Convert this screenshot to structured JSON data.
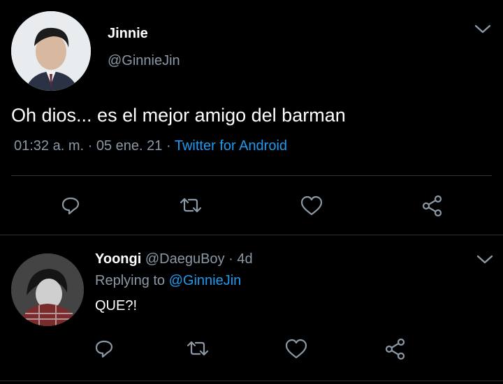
{
  "main_tweet": {
    "display_name": "Jinnie",
    "handle": "@GinnieJin",
    "text": "Oh dios... es el mejor amigo del barman",
    "time": "01:32 a. m.",
    "sep1": "·",
    "date": "05 ene. 21",
    "sep2": "·",
    "source": "Twitter for Android",
    "actions": [
      "reply-icon",
      "retweet-icon",
      "like-icon",
      "share-icon"
    ]
  },
  "reply_tweet": {
    "display_name": "Yoongi",
    "handle": "@DaeguBoy",
    "sep": "·",
    "age": "4d",
    "replying_label": "Replying to",
    "replying_handle": "@GinnieJin",
    "text": "QUE?!",
    "actions": [
      "reply-icon",
      "retweet-icon",
      "like-icon",
      "share-icon"
    ]
  },
  "colors": {
    "background": "#000000",
    "text": "#ffffff",
    "muted": "#8b98a5",
    "link": "#1d9bf0",
    "divider": "#2f3336",
    "icon": "#8b98a5"
  }
}
